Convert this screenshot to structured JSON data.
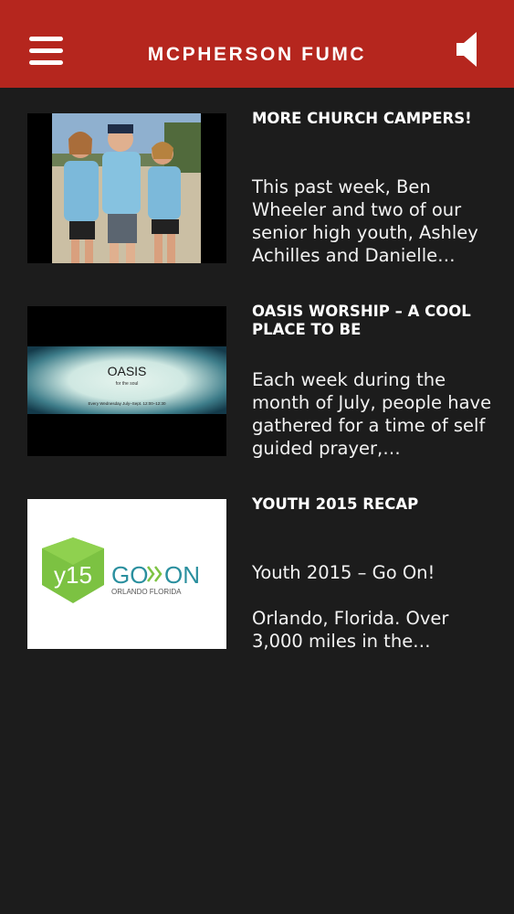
{
  "header": {
    "title": "MCPHERSON FUMC",
    "menu_icon": "hamburger-menu-icon",
    "audio_icon": "speaker-icon"
  },
  "colors": {
    "header_bg": "#b5261e",
    "page_bg": "#1c1c1c",
    "text": "#ffffff"
  },
  "posts": [
    {
      "title": "MORE CHURCH CAMPERS!",
      "excerpt": "This past week, Ben Wheeler and two of our senior high youth, Ashley Achilles and Danielle…",
      "thumbnail": "photo of three youth campers in matching light blue t-shirts"
    },
    {
      "title": "OASIS WORSHIP – A COOL PLACE TO BE",
      "excerpt": "Each week during the month of July, people have gathered for a time of self guided prayer,…",
      "thumbnail_text": {
        "title": "OASIS",
        "subtitle": "for the soul",
        "caption": "Every Wednesday July–Sept. 12:00–12:30"
      }
    },
    {
      "title": "YOUTH 2015 RECAP",
      "excerpt": "Youth 2015 – Go On!",
      "excerpt_2": "Orlando, Florida. Over 3,000 miles in the…",
      "thumbnail_text": {
        "badge": "y15",
        "go": "GO",
        "on": "ON",
        "location": "ORLANDO FLORIDA"
      }
    }
  ]
}
